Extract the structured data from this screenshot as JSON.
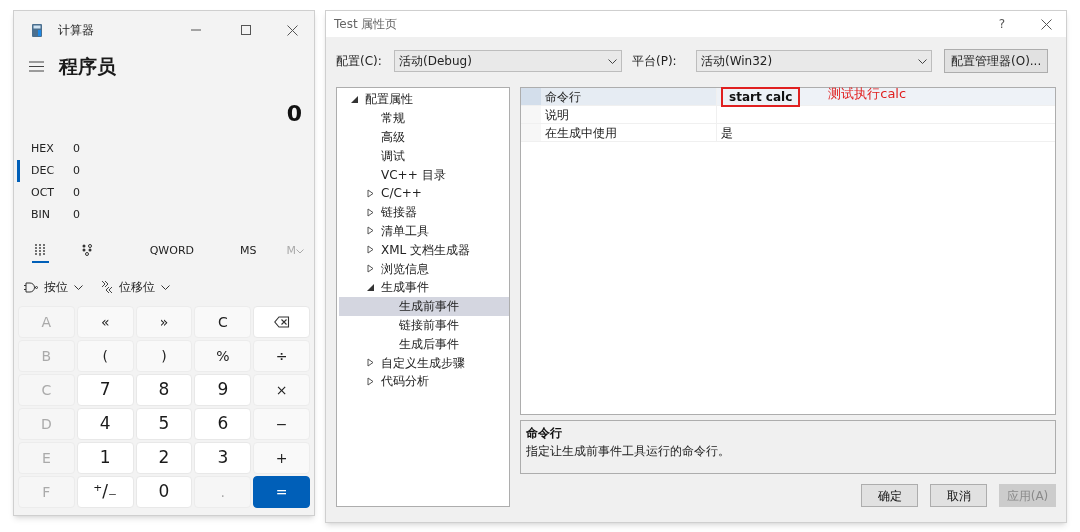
{
  "calculator": {
    "title": "计算器",
    "mode": "程序员",
    "display": "0",
    "bases": [
      {
        "label": "HEX",
        "value": "0",
        "selected": false
      },
      {
        "label": "DEC",
        "value": "0",
        "selected": true
      },
      {
        "label": "OCT",
        "value": "0",
        "selected": false
      },
      {
        "label": "BIN",
        "value": "0",
        "selected": false
      }
    ],
    "view_tabs": [
      {
        "kind": "keypad",
        "selected": true
      },
      {
        "kind": "bitpad",
        "selected": false
      }
    ],
    "word_size": "QWORD",
    "memory_save": "MS",
    "memory_menu": {
      "label": "M",
      "disabled": true
    },
    "menus": [
      {
        "kind": "bitwise",
        "label": "按位"
      },
      {
        "kind": "shift",
        "label": "位移位"
      }
    ],
    "keys": [
      {
        "label": "A",
        "kind": "digit",
        "disabled": true
      },
      {
        "label": "«",
        "kind": "op"
      },
      {
        "label": "»",
        "kind": "op"
      },
      {
        "label": "C",
        "kind": "op"
      },
      {
        "kind": "backspace"
      },
      {
        "label": "B",
        "kind": "digit",
        "disabled": true
      },
      {
        "label": "(",
        "kind": "op"
      },
      {
        "label": ")",
        "kind": "op"
      },
      {
        "label": "%",
        "kind": "op"
      },
      {
        "label": "÷",
        "kind": "op"
      },
      {
        "label": "C",
        "kind": "digit",
        "disabled": true
      },
      {
        "label": "7",
        "kind": "digit",
        "disabled": false
      },
      {
        "label": "8",
        "kind": "digit",
        "disabled": false
      },
      {
        "label": "9",
        "kind": "digit",
        "disabled": false
      },
      {
        "label": "×",
        "kind": "op"
      },
      {
        "label": "D",
        "kind": "digit",
        "disabled": true
      },
      {
        "label": "4",
        "kind": "digit",
        "disabled": false
      },
      {
        "label": "5",
        "kind": "digit",
        "disabled": false
      },
      {
        "label": "6",
        "kind": "digit",
        "disabled": false
      },
      {
        "label": "−",
        "kind": "op"
      },
      {
        "label": "E",
        "kind": "digit",
        "disabled": true
      },
      {
        "label": "1",
        "kind": "digit",
        "disabled": false
      },
      {
        "label": "2",
        "kind": "digit",
        "disabled": false
      },
      {
        "label": "3",
        "kind": "digit",
        "disabled": false
      },
      {
        "label": "+",
        "kind": "op"
      },
      {
        "label": "F",
        "kind": "digit",
        "disabled": true
      },
      {
        "label": "⁺/₋",
        "kind": "digit",
        "disabled": false
      },
      {
        "label": "0",
        "kind": "digit",
        "disabled": false
      },
      {
        "label": ".",
        "kind": "digit",
        "disabled": true
      },
      {
        "label": "=",
        "kind": "equals"
      }
    ]
  },
  "property_pages": {
    "title": "Test 属性页",
    "help": "?",
    "configuration": {
      "label": "配置(C):",
      "value": "活动(Debug)"
    },
    "platform": {
      "label": "平台(P):",
      "value": "活动(Win32)"
    },
    "manager_button": "配置管理器(O)...",
    "tree": [
      {
        "label": "配置属性",
        "expanded": true,
        "selected": false,
        "children": [
          {
            "label": "常规",
            "selected": false
          },
          {
            "label": "高级",
            "selected": false
          },
          {
            "label": "调试",
            "selected": false
          },
          {
            "label": "VC++ 目录",
            "selected": false
          },
          {
            "label": "C/C++",
            "expanded": false,
            "selected": false
          },
          {
            "label": "链接器",
            "expanded": false,
            "selected": false
          },
          {
            "label": "清单工具",
            "expanded": false,
            "selected": false
          },
          {
            "label": "XML 文档生成器",
            "expanded": false,
            "selected": false
          },
          {
            "label": "浏览信息",
            "expanded": false,
            "selected": false
          },
          {
            "label": "生成事件",
            "expanded": true,
            "selected": false,
            "children": [
              {
                "label": "生成前事件",
                "selected": true
              },
              {
                "label": "链接前事件",
                "selected": false
              },
              {
                "label": "生成后事件",
                "selected": false
              }
            ]
          },
          {
            "label": "自定义生成步骤",
            "expanded": false,
            "selected": false
          },
          {
            "label": "代码分析",
            "expanded": false,
            "selected": false
          }
        ]
      }
    ],
    "properties": [
      {
        "name": "命令行",
        "value": "start calc",
        "selected": true,
        "highlighted": true
      },
      {
        "name": "说明",
        "selected": false,
        "highlighted": false
      },
      {
        "name": "在生成中使用",
        "value": "是",
        "selected": false,
        "highlighted": false
      }
    ],
    "annotation": "测试执行calc",
    "description": {
      "title": "命令行",
      "text": "指定让生成前事件工具运行的命令行。"
    },
    "buttons": [
      {
        "label": "确定",
        "disabled": false
      },
      {
        "label": "取消",
        "disabled": false
      },
      {
        "label": "应用(A)",
        "disabled": true
      }
    ]
  }
}
